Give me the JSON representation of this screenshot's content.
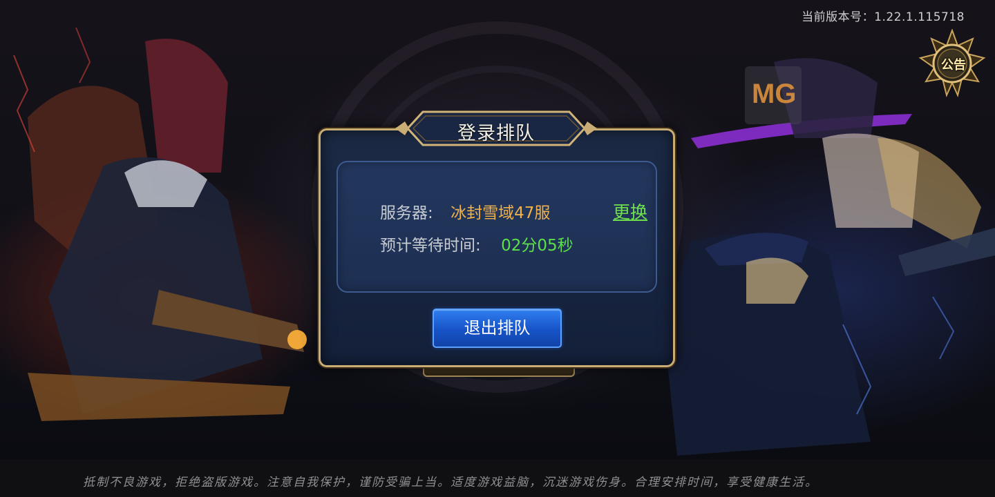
{
  "version": "当前版本号：1.22.1.115718",
  "notice_button": {
    "label": "公告"
  },
  "watermark": {
    "text": "MG"
  },
  "queue_dialog": {
    "title": "登录排队",
    "server_label": "服务器:",
    "server_name": "冰封雪域47服",
    "change_label": "更换",
    "wait_label": "预计等待时间:",
    "wait_time": "02分05秒",
    "exit_button_label": "退出排队"
  },
  "footer": {
    "health_notice": "抵制不良游戏，拒绝盗版游戏。注意自我保护，谨防受骗上当。适度游戏益脑，沉迷游戏伤身。合理安排时间，享受健康生活。"
  },
  "colors": {
    "accent_gold": "#c9ad74",
    "server_name": "#f2b24a",
    "highlight_green": "#5ee04a",
    "button_blue": "#1f64e0"
  },
  "icons": {
    "notice": "notice-badge-icon"
  }
}
